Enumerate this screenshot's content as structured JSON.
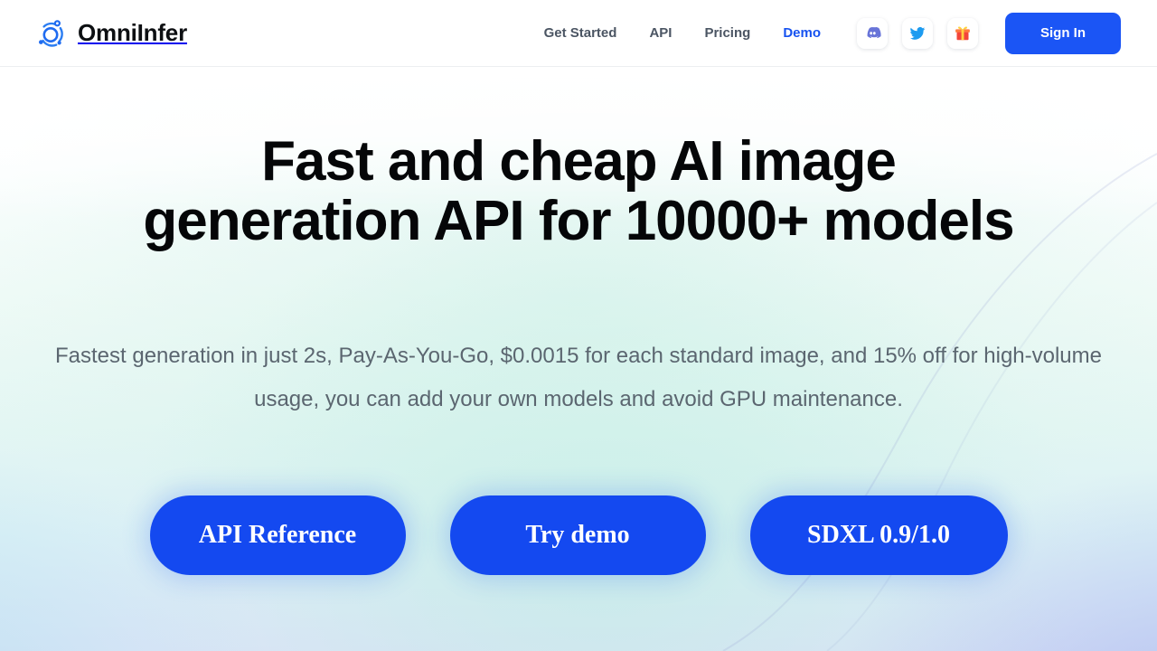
{
  "brand": {
    "name": "OmniInfer",
    "logo_icon": "omniinfer-network-logo-icon",
    "logo_color": "#1f6bf0"
  },
  "header": {
    "nav_links": [
      {
        "label": "Get Started",
        "name": "nav-link-get-started",
        "active": false
      },
      {
        "label": "API",
        "name": "nav-link-api",
        "active": false
      },
      {
        "label": "Pricing",
        "name": "nav-link-pricing",
        "active": false
      },
      {
        "label": "Demo",
        "name": "nav-link-demo",
        "active": true
      }
    ],
    "social_buttons": [
      {
        "label": "Discord",
        "icon": "discord-icon",
        "color": "#6874d8"
      },
      {
        "label": "Twitter",
        "icon": "twitter-icon",
        "color": "#1d9bf0"
      },
      {
        "label": "Gift",
        "icon": "gift-icon",
        "color": "#f3453a"
      }
    ],
    "sign_in_label": "Sign In",
    "active_link_color": "#1652f0",
    "sign_in_bg": "#1b55f5"
  },
  "hero": {
    "headline_line1": "Fast and cheap AI image",
    "headline_line2": "generation API for 10000+ models",
    "subhead": "Fastest generation in just 2s, Pay-As-You-Go, $0.0015 for each standard image, and 15% off for high-volume usage, you can add your own models and avoid GPU maintenance.",
    "cta_buttons": [
      {
        "label": "API Reference",
        "name": "cta-api-reference"
      },
      {
        "label": "Try demo",
        "name": "cta-try-demo"
      },
      {
        "label": "SDXL 0.9/1.0",
        "name": "cta-sdxl"
      }
    ],
    "cta_color": "#1449f0",
    "subhead_color": "#5b6670"
  }
}
